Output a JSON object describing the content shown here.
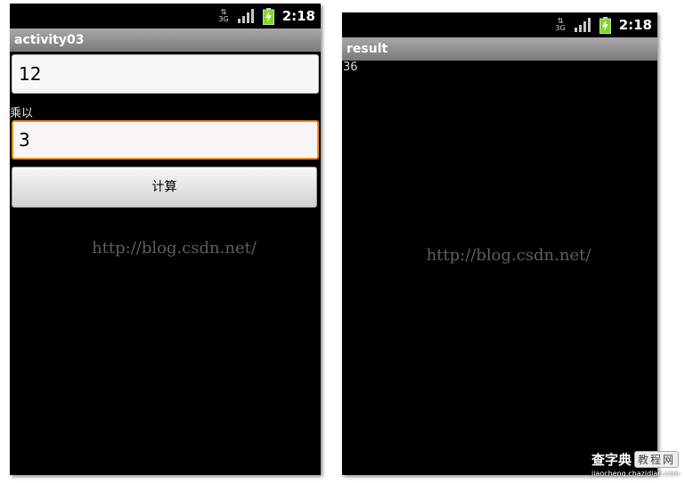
{
  "left_screen": {
    "status": {
      "network": "3G",
      "time": "2:18"
    },
    "title": "activity03",
    "input1_value": "12",
    "multiply_label": "乘以",
    "input2_value": "3",
    "button_label": "计算",
    "watermark": "http://blog.csdn.net/"
  },
  "right_screen": {
    "status": {
      "network": "3G",
      "time": "2:18"
    },
    "title": "result",
    "result_value": "36",
    "watermark": "http://blog.csdn.net/"
  },
  "site_logo": {
    "brand": "查字典",
    "tag": "教程网",
    "url": "jiaocheng.chazidian.com"
  },
  "colors": {
    "focus_border": "#f08d1a",
    "titlebar": "#8f8f8f",
    "battery": "#7bdc1e"
  },
  "icons": [
    "network-3g-icon",
    "signal-icon",
    "battery-charging-icon"
  ]
}
